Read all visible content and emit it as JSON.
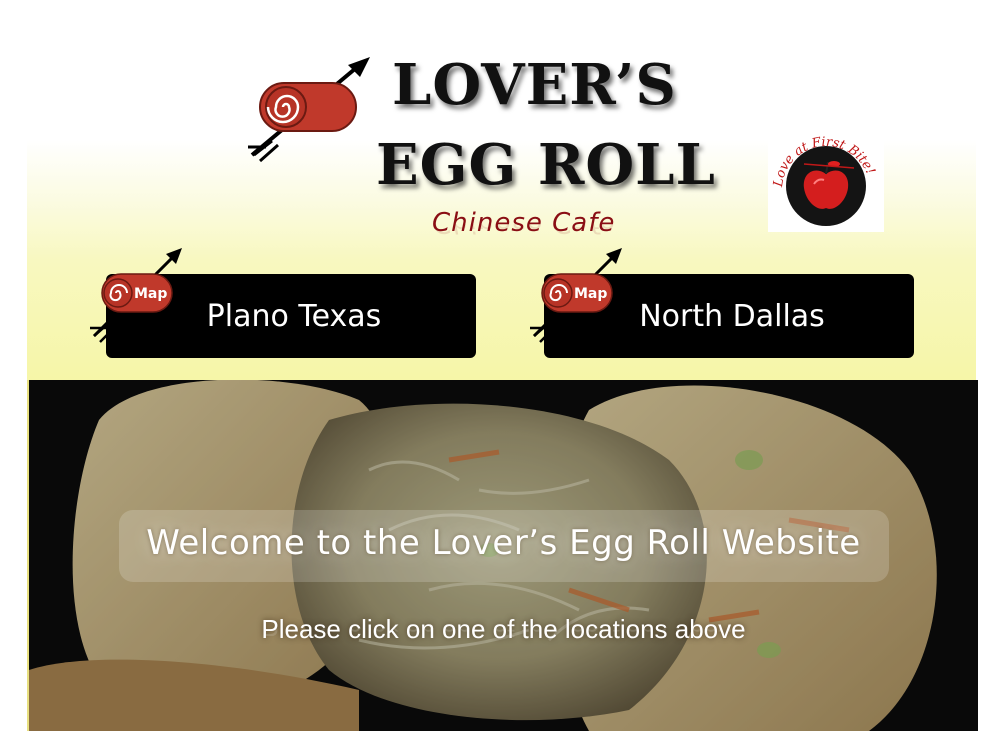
{
  "header": {
    "title_line1": "LOVER’S",
    "title_line2": "EGG ROLL",
    "subtitle": "Chinese Cafe",
    "badge_text": "Love at First Bite!"
  },
  "locations": [
    {
      "label": "Plano Texas",
      "map_label": "Map"
    },
    {
      "label": "North Dallas",
      "map_label": "Map"
    }
  ],
  "hero": {
    "welcome": "Welcome to the Lover’s Egg Roll Website",
    "instruction": "Please click on one of the locations above"
  },
  "colors": {
    "brand_red": "#c0392b",
    "subtitle_red": "#8a0e14",
    "button_black": "#000000",
    "header_yellow": "#f6f6a8"
  }
}
